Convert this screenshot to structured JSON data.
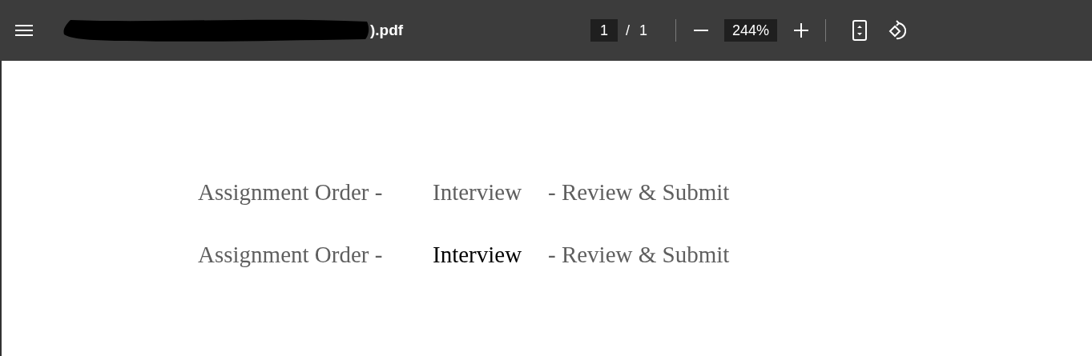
{
  "toolbar": {
    "title": ").pdf",
    "page_input": "1",
    "page_separator": "/",
    "page_total": "1",
    "zoom": "244%"
  },
  "document": {
    "lines": [
      {
        "segments": [
          {
            "text": "Assignment Order -",
            "emphasized": false
          },
          {
            "text": "Interview",
            "emphasized": false
          },
          {
            "text": "- Review & Submit",
            "emphasized": false
          }
        ]
      },
      {
        "segments": [
          {
            "text": "Assignment Order -",
            "emphasized": false
          },
          {
            "text": "Interview",
            "emphasized": true
          },
          {
            "text": "- Review & Submit",
            "emphasized": false
          }
        ]
      }
    ]
  }
}
